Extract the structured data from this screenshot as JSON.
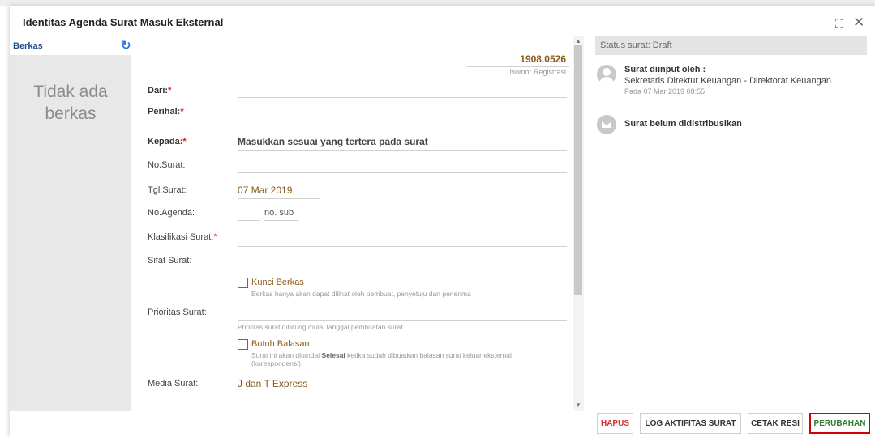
{
  "dialog": {
    "title": "Identitas Agenda Surat Masuk Eksternal",
    "expand_icon": "expand-icon",
    "close_icon": "close-icon"
  },
  "left": {
    "header": "Berkas",
    "empty_text_line1": "Tidak ada",
    "empty_text_line2": "berkas"
  },
  "form": {
    "registration_number": "1908.0526",
    "registration_label": "Nomor Registrasi",
    "dari_label": "Dari:",
    "perihal_label": "Perihal:",
    "kepada_label": "Kepada:",
    "kepada_value": "Masukkan sesuai yang tertera pada surat",
    "no_surat_label": "No.Surat:",
    "tgl_surat_label": "Tgl.Surat:",
    "tgl_surat_value": "07 Mar 2019",
    "no_agenda_label": "No.Agenda:",
    "no_sub": "no. sub",
    "klasifikasi_label": "Klasifikasi Surat:",
    "sifat_label": "Sifat Surat:",
    "kunci_berkas_label": "Kunci Berkas",
    "kunci_berkas_help": "Berkas hanya akan dapat dilihat oleh pembuat, penyetuju dan penerima",
    "prioritas_label": "Prioritas Surat:",
    "prioritas_help": "Prioritas surat dihitung mulai tanggal pembuatan surat",
    "butuh_balasan_label": "Butuh Balasan",
    "butuh_balasan_help_pre": "Surat ini akan ditandai ",
    "butuh_balasan_help_bold": "Selesai",
    "butuh_balasan_help_post": " ketika sudah dibuatkan balasan surat keluar eksternal",
    "butuh_balasan_help_line2": "(korespondensi)",
    "media_label": "Media Surat:",
    "media_value": "J dan T Express"
  },
  "status": {
    "text": "Status surat: Draft",
    "activity1_title": "Surat diinput oleh :",
    "activity1_sub": "Sekretaris Direktur Keuangan - Direktorat Keuangan",
    "activity1_date": "Pada 07 Mar 2019 08:55",
    "activity2_title": "Surat belum didistribusikan"
  },
  "buttons": {
    "hapus": "HAPUS",
    "log": "LOG AKTIFITAS SURAT",
    "cetak": "CETAK RESI",
    "perubahan": "PERUBAHAN"
  },
  "colors": {
    "accent_value": "#8a5a1a",
    "berkas_blue": "#1f4e8c",
    "delete_red": "#d32f2f",
    "perubahan_green": "#2e7d32",
    "highlight_red": "#d40000"
  }
}
